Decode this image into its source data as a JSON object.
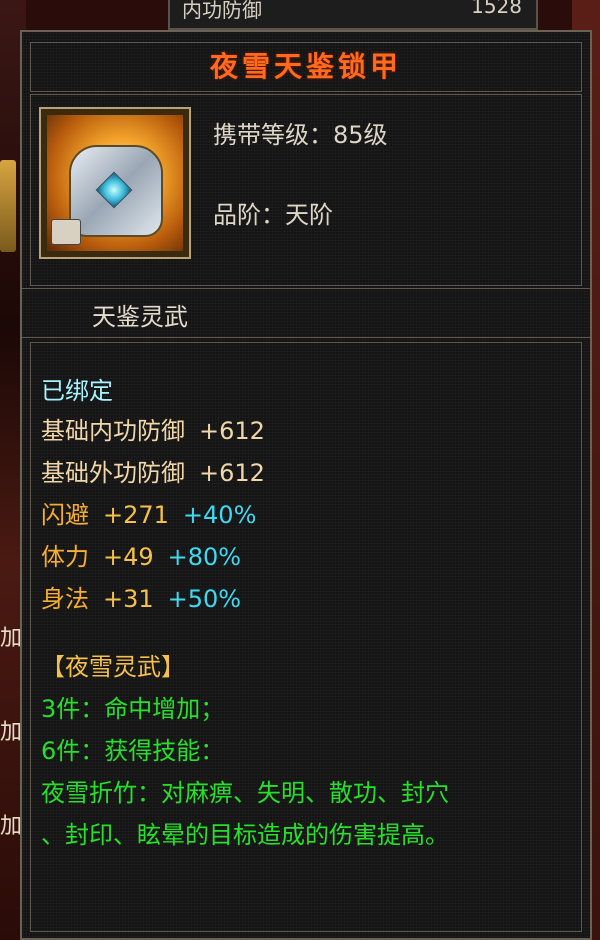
{
  "background": {
    "top_stat_label": "内功防御",
    "top_stat_value": "1528",
    "side_chars": [
      "加",
      "加",
      "加"
    ]
  },
  "tooltip": {
    "item_name": "夜雪天鉴锁甲",
    "item_icon": "armor-icon",
    "level_req": "携带等级：85级",
    "grade": "品阶：天阶",
    "set_title": "天鉴灵武",
    "bind_status": "已绑定",
    "base_stats": [
      {
        "name": "基础内功防御",
        "value": "+612"
      },
      {
        "name": "基础外功防御",
        "value": "+612"
      }
    ],
    "attributes": [
      {
        "name": "闪避",
        "value": "+271",
        "bonus": "+40%"
      },
      {
        "name": "体力",
        "value": "+49",
        "bonus": "+80%"
      },
      {
        "name": "身法",
        "value": "+31",
        "bonus": "+50%"
      }
    ],
    "set": {
      "name": "【夜雪灵武】",
      "bonus_3": "3件：命中增加；",
      "bonus_6": "6件：获得技能：",
      "skill_line1": "夜雪折竹：对麻痹、失明、散功、封穴",
      "skill_line2": "、封印、眩晕的目标造成的伤害提高。"
    }
  },
  "colors": {
    "title": "#ff6a1e",
    "bind": "#a6f2ff",
    "base_stat": "#f1d7a9",
    "attribute": "#f7ad2f",
    "bonus": "#3fd9f2",
    "set": "#27e02c"
  }
}
